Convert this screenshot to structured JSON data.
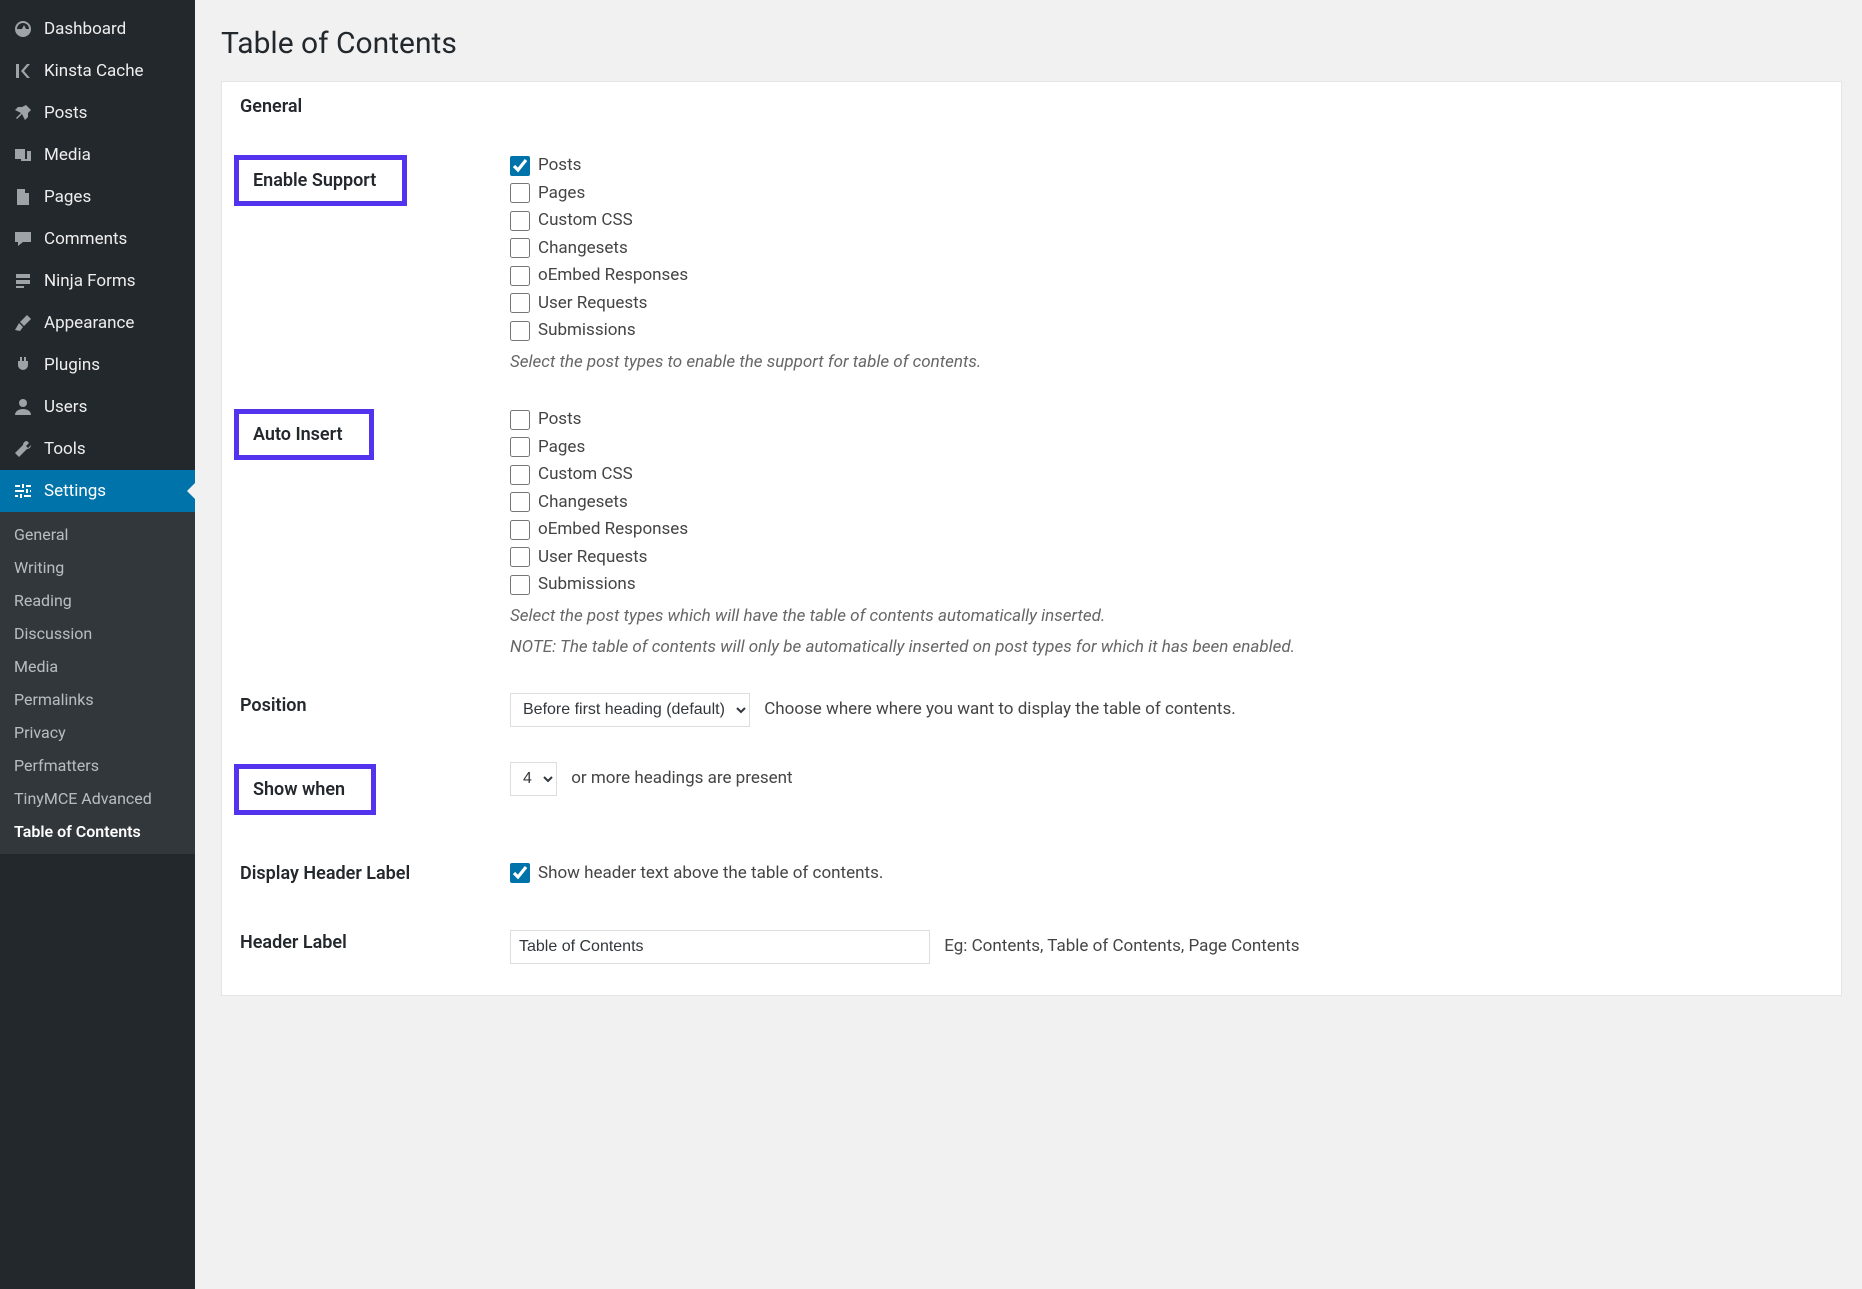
{
  "page": {
    "title": "Table of Contents"
  },
  "sidebar": {
    "main": [
      {
        "label": "Dashboard",
        "icon": "dashboard"
      },
      {
        "label": "Kinsta Cache",
        "icon": "kinsta"
      },
      {
        "label": "Posts",
        "icon": "pin"
      },
      {
        "label": "Media",
        "icon": "media"
      },
      {
        "label": "Pages",
        "icon": "page"
      },
      {
        "label": "Comments",
        "icon": "comment"
      },
      {
        "label": "Ninja Forms",
        "icon": "form"
      },
      {
        "label": "Appearance",
        "icon": "brush"
      },
      {
        "label": "Plugins",
        "icon": "plug"
      },
      {
        "label": "Users",
        "icon": "user"
      },
      {
        "label": "Tools",
        "icon": "wrench"
      },
      {
        "label": "Settings",
        "icon": "sliders",
        "active": true
      }
    ],
    "settings_submenu": [
      "General",
      "Writing",
      "Reading",
      "Discussion",
      "Media",
      "Permalinks",
      "Privacy",
      "Perfmatters",
      "TinyMCE Advanced",
      "Table of Contents"
    ]
  },
  "panel": {
    "tab": "General",
    "enable_support": {
      "label": "Enable Support",
      "options": [
        "Posts",
        "Pages",
        "Custom CSS",
        "Changesets",
        "oEmbed Responses",
        "User Requests",
        "Submissions"
      ],
      "checked": [
        true,
        false,
        false,
        false,
        false,
        false,
        false
      ],
      "description": "Select the post types to enable the support for table of contents."
    },
    "auto_insert": {
      "label": "Auto Insert",
      "options": [
        "Posts",
        "Pages",
        "Custom CSS",
        "Changesets",
        "oEmbed Responses",
        "User Requests",
        "Submissions"
      ],
      "checked": [
        false,
        false,
        false,
        false,
        false,
        false,
        false
      ],
      "description": "Select the post types which will have the table of contents automatically inserted.",
      "note": "NOTE: The table of contents will only be automatically inserted on post types for which it has been enabled."
    },
    "position": {
      "label": "Position",
      "value": "Before first heading (default)",
      "help": "Choose where where you want to display the table of contents."
    },
    "show_when": {
      "label": "Show when",
      "value": "4",
      "suffix": "or more headings are present"
    },
    "display_header_label": {
      "label": "Display Header Label",
      "checked": true,
      "text": "Show header text above the table of contents."
    },
    "header_label": {
      "label": "Header Label",
      "value": "Table of Contents",
      "help": "Eg: Contents, Table of Contents, Page Contents"
    }
  }
}
